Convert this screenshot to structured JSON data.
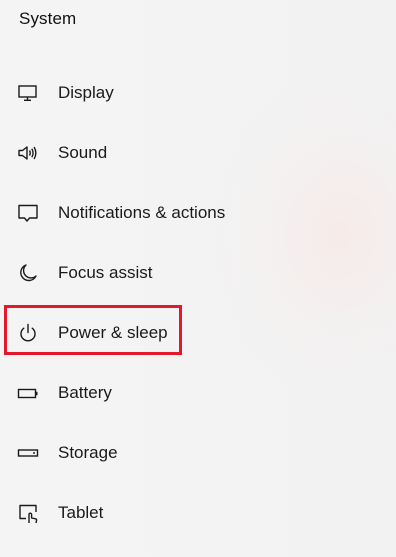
{
  "header": {
    "title": "System"
  },
  "nav": {
    "items": [
      {
        "label": "Display",
        "icon": "display-icon"
      },
      {
        "label": "Sound",
        "icon": "speaker-icon"
      },
      {
        "label": "Notifications & actions",
        "icon": "notification-icon"
      },
      {
        "label": "Focus assist",
        "icon": "moon-icon"
      },
      {
        "label": "Power & sleep",
        "icon": "power-icon"
      },
      {
        "label": "Battery",
        "icon": "battery-icon"
      },
      {
        "label": "Storage",
        "icon": "storage-icon"
      },
      {
        "label": "Tablet",
        "icon": "tablet-icon"
      }
    ]
  },
  "highlight": {
    "target": "Power & sleep",
    "color": "#e3182d"
  },
  "colors": {
    "text": "#1a1a1a",
    "background": "#f3f3f3"
  }
}
